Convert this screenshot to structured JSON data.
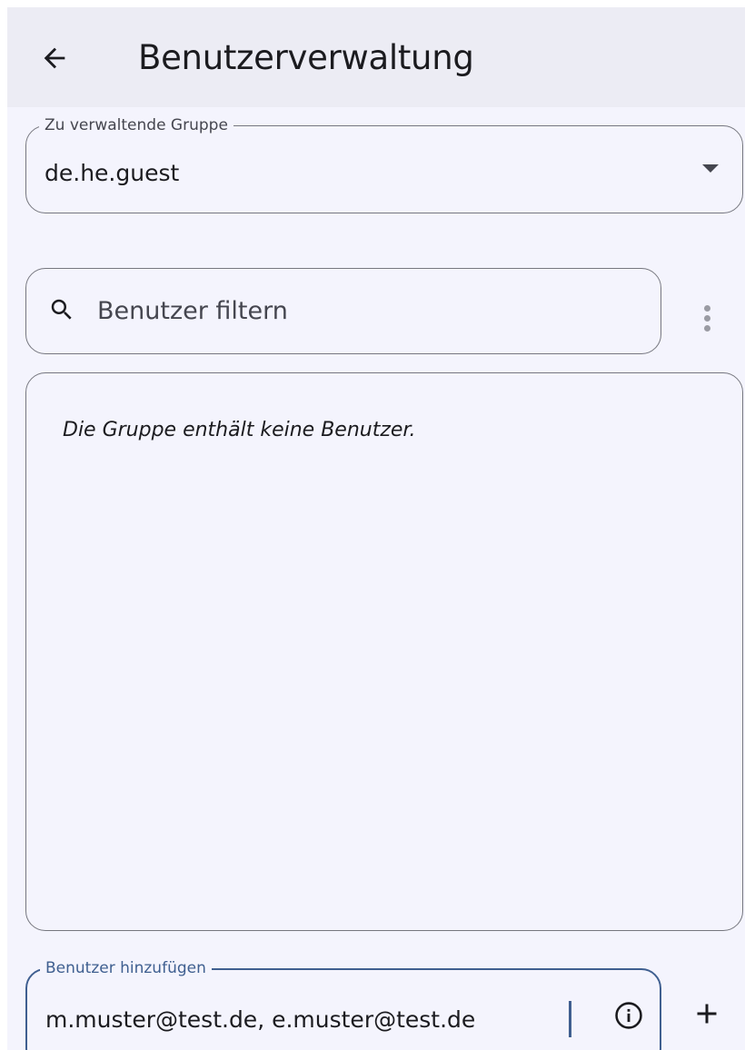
{
  "appbar": {
    "title": "Benutzerverwaltung",
    "back_icon": "arrow-back-icon"
  },
  "group_select": {
    "label": "Zu verwaltende Gruppe",
    "value": "de.he.guest",
    "icon": "dropdown-arrow-icon"
  },
  "search": {
    "placeholder": "Benutzer filtern",
    "icon": "search-icon"
  },
  "more_menu": {
    "icon": "more-vert-icon"
  },
  "user_list": {
    "empty_message": "Die Gruppe enthält keine Benutzer."
  },
  "add_users": {
    "label": "Benutzer hinzufügen",
    "value": "m.muster@test.de, e.muster@test.de",
    "info_icon": "info-icon",
    "add_icon": "plus-icon"
  },
  "colors": {
    "background": "#f4f4fd",
    "appbar": "#ececf4",
    "outline": "#76777f",
    "focus": "#3f5f90"
  }
}
